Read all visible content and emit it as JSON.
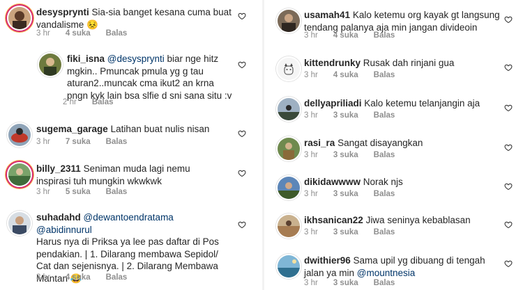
{
  "left": [
    {
      "user": "desysprynti",
      "text": "Sia-sia banget kesana cuma buat vandalisme 😣",
      "time": "3 hr",
      "likes": "4 suka",
      "reply": "Balas"
    },
    {
      "user": "fiki_isna",
      "mention": "@desysprynti",
      "text": " biar nge hitz mgkin.. Pmuncak pmula yg g tau aturan2..muncak cma ikut2 an krna pngn kyk lain bsa slfie d sni sana situ :v",
      "time": "2 hr",
      "reply": "Balas"
    },
    {
      "user": "sugema_garage",
      "text": "Latihan buat nulis nisan",
      "time": "3 hr",
      "likes": "7 suka",
      "reply": "Balas"
    },
    {
      "user": "billy_2311",
      "text": "Seniman muda lagi nemu inspirasi tuh mungkin wkwkwk",
      "time": "3 hr",
      "likes": "5 suka",
      "reply": "Balas"
    },
    {
      "user": "suhadahd",
      "mention": "@dewantoendratama @abidinnurul",
      "text": "Harus nya di Priksa ya lee pas daftar di Pos pendakian. | 1. Dilarang membawa Sepidol/ Cat dan sejenisnya. | 2. Dilarang Membawa Mantan 😂",
      "time": "3 hr",
      "likes": "4 suka",
      "reply": "Balas"
    }
  ],
  "right": [
    {
      "user": "usamah41",
      "text": "Kalo ketemu org kayak gt langsung tendang palanya aja min jangan divideoin",
      "time": "3 hr",
      "likes": "4 suka",
      "reply": "Balas"
    },
    {
      "user": "kittendrunky",
      "text": "Rusak dah rinjani gua",
      "time": "3 hr",
      "likes": "4 suka",
      "reply": "Balas"
    },
    {
      "user": "dellyapriliadi",
      "text": "Kalo ketemu telanjangin aja",
      "time": "3 hr",
      "likes": "3 suka",
      "reply": "Balas"
    },
    {
      "user": "rasi_ra",
      "text": "Sangat disayangkan",
      "time": "3 hr",
      "likes": "3 suka",
      "reply": "Balas"
    },
    {
      "user": "dikidawwww",
      "text": "Norak njs",
      "time": "3 hr",
      "likes": "3 suka",
      "reply": "Balas"
    },
    {
      "user": "ikhsanican22",
      "text": "Jiwa seninya kebablasan",
      "time": "3 hr",
      "likes": "3 suka",
      "reply": "Balas"
    },
    {
      "user": "dwithier96",
      "text": "Sama upil yg dibuang di tengah jalan ya min ",
      "mention": "@mountnesia",
      "time": "3 hr",
      "likes": "3 suka",
      "reply": "Balas"
    }
  ]
}
